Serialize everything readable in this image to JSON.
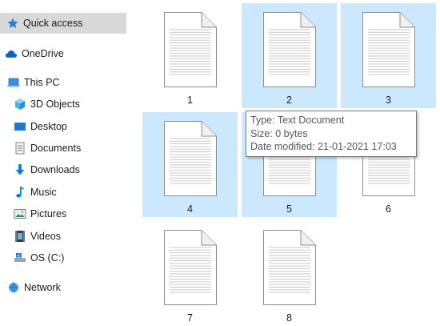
{
  "sidebar": {
    "items": [
      {
        "label": "Quick access",
        "icon": "star-icon"
      },
      {
        "label": "OneDrive",
        "icon": "cloud-icon"
      },
      {
        "label": "This PC",
        "icon": "pc-icon"
      },
      {
        "label": "3D Objects",
        "icon": "cube-icon"
      },
      {
        "label": "Desktop",
        "icon": "desktop-icon"
      },
      {
        "label": "Documents",
        "icon": "documents-icon"
      },
      {
        "label": "Downloads",
        "icon": "download-icon"
      },
      {
        "label": "Music",
        "icon": "music-icon"
      },
      {
        "label": "Pictures",
        "icon": "pictures-icon"
      },
      {
        "label": "Videos",
        "icon": "videos-icon"
      },
      {
        "label": "OS (C:)",
        "icon": "drive-icon"
      },
      {
        "label": "Network",
        "icon": "network-icon"
      }
    ]
  },
  "files": [
    {
      "name": "1",
      "selected": false
    },
    {
      "name": "2",
      "selected": true
    },
    {
      "name": "3",
      "selected": true
    },
    {
      "name": "4",
      "selected": true
    },
    {
      "name": "5",
      "selected": true
    },
    {
      "name": "6",
      "selected": false
    },
    {
      "name": "7",
      "selected": false
    },
    {
      "name": "8",
      "selected": false
    }
  ],
  "tooltip": {
    "type": "Type: Text Document",
    "size": "Size: 0 bytes",
    "modified": "Date modified: 21-01-2021 17:03"
  },
  "colors": {
    "selection": "#cce8ff",
    "nav_selected": "#d9d9d9",
    "accent": "#0078d7"
  }
}
